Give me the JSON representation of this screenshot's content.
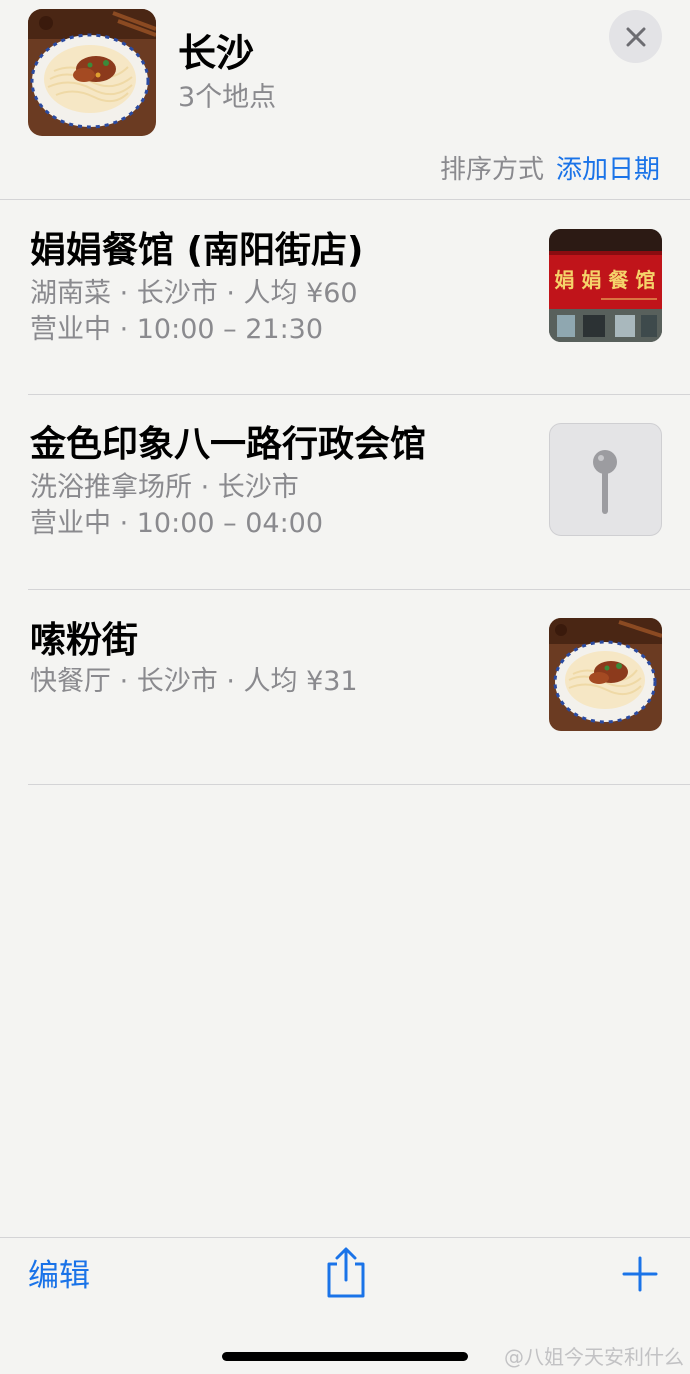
{
  "header": {
    "title": "长沙",
    "subtitle": "3个地点",
    "close_icon": "close-icon"
  },
  "sort": {
    "label": "排序方式",
    "value": "添加日期"
  },
  "places": [
    {
      "name": "娟娟餐馆 (南阳街店)",
      "meta1": "湖南菜 · 长沙市 · 人均 ¥60",
      "meta2": "营业中 · 10:00 – 21:30",
      "thumb": "storefront-photo",
      "sign_text": "娟 娟 餐 馆"
    },
    {
      "name": "金色印象八一路行政会馆",
      "meta1": "洗浴推拿场所 · 长沙市",
      "meta2": "营业中 · 10:00 – 04:00",
      "thumb": "pin-icon"
    },
    {
      "name": "嗦粉街",
      "meta1": "快餐厅 · 长沙市 · 人均 ¥31",
      "thumb": "noodle-bowl-photo"
    }
  ],
  "toolbar": {
    "edit_label": "编辑",
    "share_icon": "share-icon",
    "add_icon": "plus-icon"
  },
  "watermark": "@八姐今天安利什么",
  "colors": {
    "accent": "#1a73e8",
    "secondary_text": "#8a8a8e",
    "background": "#f4f4f2"
  }
}
